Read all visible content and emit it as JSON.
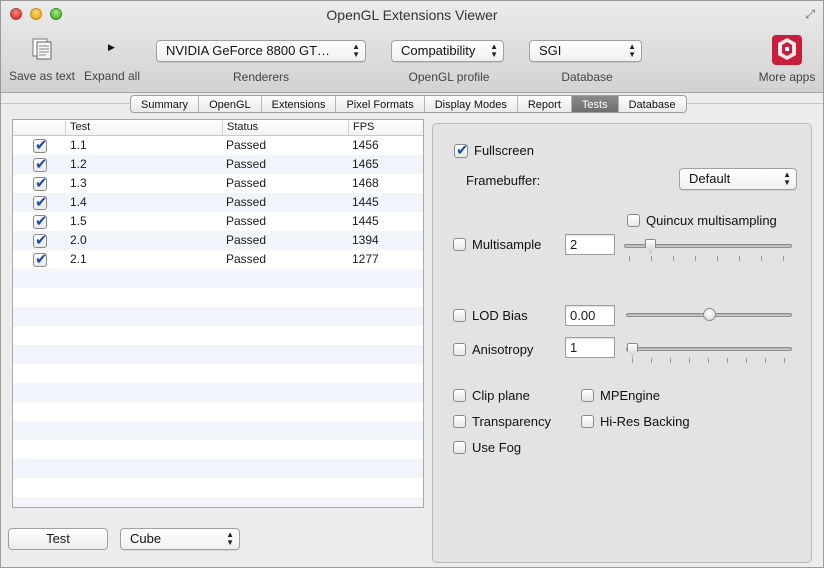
{
  "window": {
    "title": "OpenGL Extensions Viewer"
  },
  "toolbar": {
    "save_label": "Save as text",
    "expand_label": "Expand all",
    "renderer_value": "NVIDIA GeForce 8800 GT…",
    "renderer_label": "Renderers",
    "profile_value": "Compatibility",
    "profile_label": "OpenGL profile",
    "database_value": "SGI",
    "database_label": "Database",
    "more_apps_label": "More apps"
  },
  "tabs": [
    {
      "label": "Summary",
      "active": false
    },
    {
      "label": "OpenGL",
      "active": false
    },
    {
      "label": "Extensions",
      "active": false
    },
    {
      "label": "Pixel Formats",
      "active": false
    },
    {
      "label": "Display Modes",
      "active": false
    },
    {
      "label": "Report",
      "active": false
    },
    {
      "label": "Tests",
      "active": true
    },
    {
      "label": "Database",
      "active": false
    }
  ],
  "table": {
    "columns": [
      "",
      "Test",
      "Status",
      "FPS"
    ],
    "rows": [
      {
        "checked": true,
        "test": "1.1",
        "status": "Passed",
        "fps": "1456"
      },
      {
        "checked": true,
        "test": "1.2",
        "status": "Passed",
        "fps": "1465"
      },
      {
        "checked": true,
        "test": "1.3",
        "status": "Passed",
        "fps": "1468"
      },
      {
        "checked": true,
        "test": "1.4",
        "status": "Passed",
        "fps": "1445"
      },
      {
        "checked": true,
        "test": "1.5",
        "status": "Passed",
        "fps": "1445"
      },
      {
        "checked": true,
        "test": "2.0",
        "status": "Passed",
        "fps": "1394"
      },
      {
        "checked": true,
        "test": "2.1",
        "status": "Passed",
        "fps": "1277"
      }
    ]
  },
  "options": {
    "fullscreen_label": "Fullscreen",
    "fullscreen_checked": true,
    "framebuffer_label": "Framebuffer:",
    "framebuffer_value": "Default",
    "quincux_label": "Quincux multisampling",
    "multisample_label": "Multisample",
    "multisample_value": "2",
    "lod_bias_label": "LOD Bias",
    "lod_bias_value": "0.00",
    "anisotropy_label": "Anisotropy",
    "anisotropy_value": "1",
    "clip_plane_label": "Clip plane",
    "mpengine_label": "MPEngine",
    "transparency_label": "Transparency",
    "hires_label": "Hi-Res Backing",
    "use_fog_label": "Use Fog"
  },
  "bottom": {
    "test_button": "Test",
    "shape_value": "Cube"
  },
  "icons": {
    "save": "document-icon",
    "expand": "disclosure-triangle-icon",
    "more_apps": "realtech-vr-logo-icon"
  },
  "colors": {
    "accent": "#1b4fa0",
    "logo": "#c81e3c"
  }
}
